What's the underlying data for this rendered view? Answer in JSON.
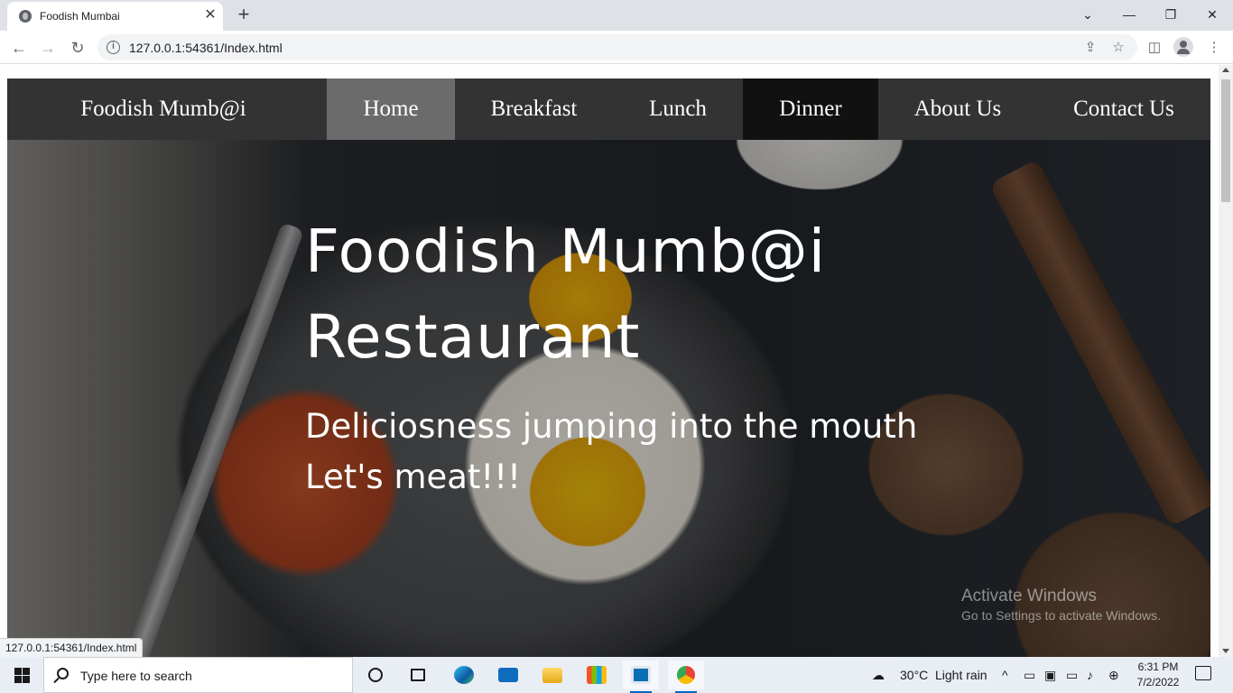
{
  "browser": {
    "tab_title": "Foodish Mumbai",
    "tab_close": "✕",
    "new_tab": "+",
    "url": "127.0.0.1:54361/Index.html",
    "window_controls": {
      "minimize": "—",
      "restore": "❐",
      "close": "✕"
    },
    "status_url": "127.0.0.1:54361/Index.html"
  },
  "site": {
    "brand": "Foodish Mumb@i",
    "nav": {
      "home": "Home",
      "breakfast": "Breakfast",
      "lunch": "Lunch",
      "dinner": "Dinner",
      "about": "About Us",
      "contact": "Contact Us"
    },
    "hero": {
      "title_line1": "Foodish Mumb@i",
      "title_line2": "Restaurant",
      "tagline_line1": "Deliciosness jumping into the mouth",
      "tagline_line2": "Let's meat!!!"
    }
  },
  "watermark": {
    "title": "Activate Windows",
    "subtitle": "Go to Settings to activate Windows."
  },
  "taskbar": {
    "search_placeholder": "Type here to search",
    "weather_temp": "30°C",
    "weather_desc": "Light rain",
    "time": "6:31 PM",
    "date": "7/2/2022"
  },
  "colors": {
    "nav_bg": "#333333",
    "nav_active": "#6b6b6b",
    "nav_dark": "#111111"
  }
}
